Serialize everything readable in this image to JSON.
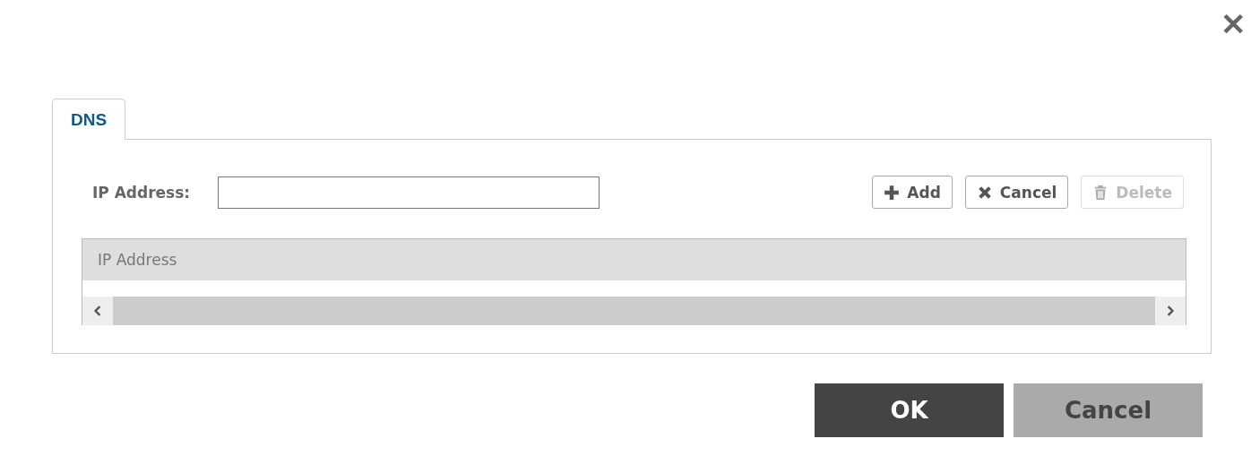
{
  "close_button": {
    "label": "✕"
  },
  "tabs": [
    {
      "label": "DNS",
      "selected": true
    }
  ],
  "form": {
    "label": "IP Address:"
  },
  "toolbar": [
    {
      "kind": "add",
      "label": "Add",
      "disabled": false
    },
    {
      "kind": "cancel",
      "label": "Cancel",
      "disabled": false
    },
    {
      "kind": "delete",
      "label": "Delete",
      "disabled": true
    }
  ],
  "table": {
    "columns": [
      "IP Address"
    ]
  },
  "buttons": [
    {
      "kind": "primary",
      "label": "OK"
    },
    {
      "kind": "secondary",
      "label": "Cancel"
    }
  ]
}
